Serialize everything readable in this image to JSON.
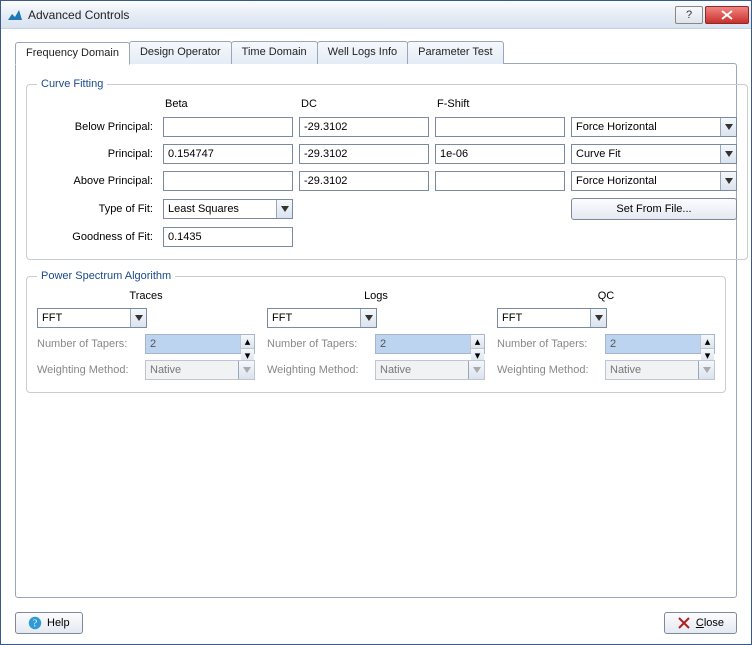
{
  "window": {
    "title": "Advanced Controls"
  },
  "tabs": {
    "t0": "Frequency Domain",
    "t1": "Design Operator",
    "t2": "Time Domain",
    "t3": "Well Logs Info",
    "t4": "Parameter Test"
  },
  "curveFitting": {
    "legend": "Curve Fitting",
    "headers": {
      "beta": "Beta",
      "dc": "DC",
      "fshift": "F-Shift"
    },
    "rows": {
      "below": {
        "label": "Below Principal:",
        "beta": "",
        "dc": "-29.3102",
        "fshift": "",
        "mode": "Force Horizontal"
      },
      "principal": {
        "label": "Principal:",
        "beta": "0.154747",
        "dc": "-29.3102",
        "fshift": "1e-06",
        "mode": "Curve Fit"
      },
      "above": {
        "label": "Above Principal:",
        "beta": "",
        "dc": "-29.3102",
        "fshift": "",
        "mode": "Force Horizontal"
      }
    },
    "typeOfFit": {
      "label": "Type of Fit:",
      "value": "Least Squares"
    },
    "setFromFile": "Set From File...",
    "goodness": {
      "label": "Goodness of Fit:",
      "value": "0.1435"
    }
  },
  "psa": {
    "legend": "Power Spectrum Algorithm",
    "columns": {
      "traces": {
        "header": "Traces",
        "algo": "FFT",
        "tapersLabel": "Number of Tapers:",
        "tapers": "2",
        "weightLabel": "Weighting Method:",
        "weight": "Native"
      },
      "logs": {
        "header": "Logs",
        "algo": "FFT",
        "tapersLabel": "Number of Tapers:",
        "tapers": "2",
        "weightLabel": "Weighting Method:",
        "weight": "Native"
      },
      "qc": {
        "header": "QC",
        "algo": "FFT",
        "tapersLabel": "Number of Tapers:",
        "tapers": "2",
        "weightLabel": "Weighting Method:",
        "weight": "Native"
      }
    }
  },
  "footer": {
    "help": "Help",
    "close": "Close"
  }
}
